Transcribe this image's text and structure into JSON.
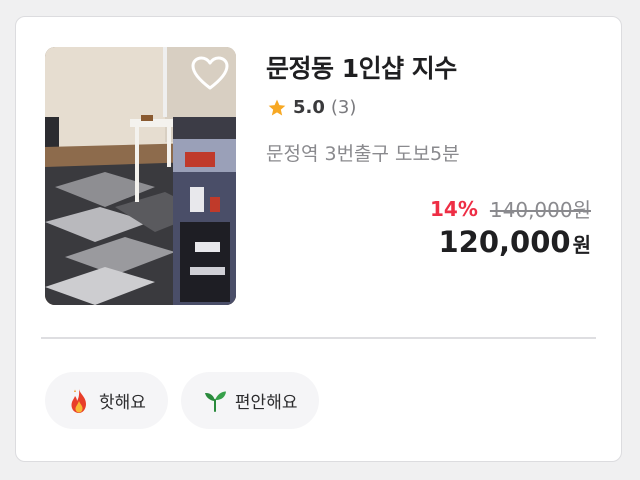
{
  "listing": {
    "title": "문정동 1인샵 지수",
    "rating": "5.0",
    "review_count": "(3)",
    "location": "문정역 3번출구 도보5분",
    "discount": "14%",
    "original_price": "140,000원",
    "price": "120,000",
    "price_unit": "원",
    "icons": {
      "favorite": "heart-outline-icon",
      "rating": "star-icon"
    }
  },
  "tags": [
    {
      "label": "핫해요",
      "icon": "fire-icon"
    },
    {
      "label": "편안해요",
      "icon": "leaf-icon"
    }
  ],
  "colors": {
    "discount": "#ee2e45",
    "star": "#f7a823",
    "leaf": "#2a8a3c",
    "fire": "#e83e2a"
  }
}
